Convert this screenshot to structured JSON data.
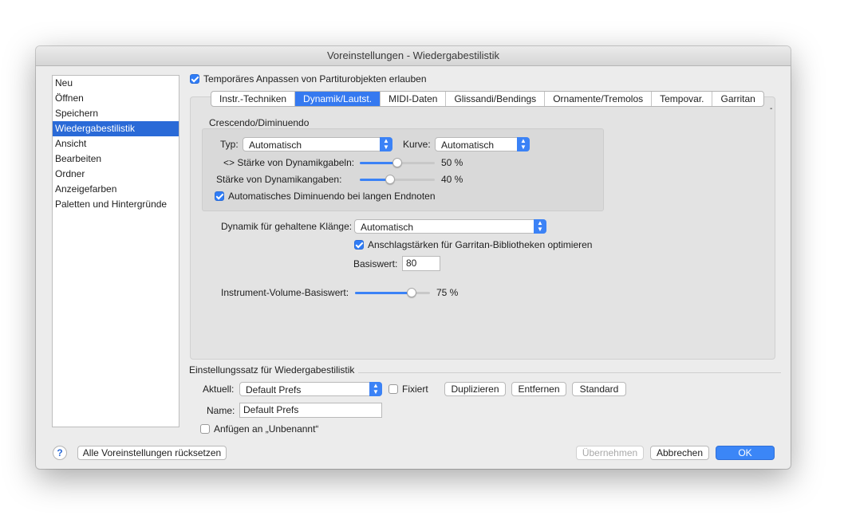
{
  "window": {
    "title": "Voreinstellungen - Wiedergabestilistik"
  },
  "sidebar": {
    "items": [
      {
        "label": "Neu"
      },
      {
        "label": "Öffnen"
      },
      {
        "label": "Speichern"
      },
      {
        "label": "Wiedergabestilistik",
        "selected": true
      },
      {
        "label": "Ansicht"
      },
      {
        "label": "Bearbeiten"
      },
      {
        "label": "Ordner"
      },
      {
        "label": "Anzeigefarben"
      },
      {
        "label": "Paletten und Hintergründe"
      }
    ]
  },
  "temp_adjust": {
    "label": "Temporäres Anpassen von Partiturobjekten erlauben",
    "checked": true
  },
  "tabs": [
    {
      "label": "Instr.-Techniken"
    },
    {
      "label": "Dynamik/Lautst.",
      "active": true
    },
    {
      "label": "MIDI-Daten"
    },
    {
      "label": "Glissandi/Bendings"
    },
    {
      "label": "Ornamente/Tremolos"
    },
    {
      "label": "Tempovar."
    },
    {
      "label": "Garritan"
    }
  ],
  "crescendo": {
    "title": "Crescendo/Diminuendo",
    "typ_label": "Typ:",
    "typ_value": "Automatisch",
    "kurve_label": "Kurve:",
    "kurve_value": "Automatisch",
    "hairpin_label": "<> Stärke von Dynamikgabeln:",
    "hairpin_value": 50,
    "hairpin_text": "50 %",
    "dynamic_label": "Stärke von Dynamikangaben:",
    "dynamic_value": 40,
    "dynamic_text": "40 %",
    "auto_dim_label": "Automatisches Diminuendo bei langen Endnoten",
    "auto_dim_checked": true
  },
  "sustained": {
    "label": "Dynamik für gehaltene Klänge:",
    "value": "Automatisch",
    "garritan_label": "Anschlagstärken für Garritan-Bibliotheken optimieren",
    "garritan_checked": true,
    "base_label": "Basiswert:",
    "base_value": "80"
  },
  "volume": {
    "label": "Instrument-Volume-Basiswert:",
    "value": 75,
    "text": "75 %"
  },
  "prefs_set": {
    "title": "Einstellungssatz für Wiedergabestilistik",
    "current_label": "Aktuell:",
    "current_value": "Default Prefs",
    "fixed_label": "Fixiert",
    "fixed_checked": false,
    "duplicate": "Duplizieren",
    "remove": "Entfernen",
    "standard": "Standard",
    "name_label": "Name:",
    "name_value": "Default Prefs",
    "append_label": "Anfügen an „Unbenannt“",
    "append_checked": false
  },
  "footer": {
    "help": "?",
    "reset_all": "Alle Voreinstellungen rücksetzen",
    "apply": "Übernehmen",
    "cancel": "Abbrechen",
    "ok": "OK"
  },
  "colors": {
    "accent": "#3b82f6",
    "selection": "#2a6ad7"
  }
}
